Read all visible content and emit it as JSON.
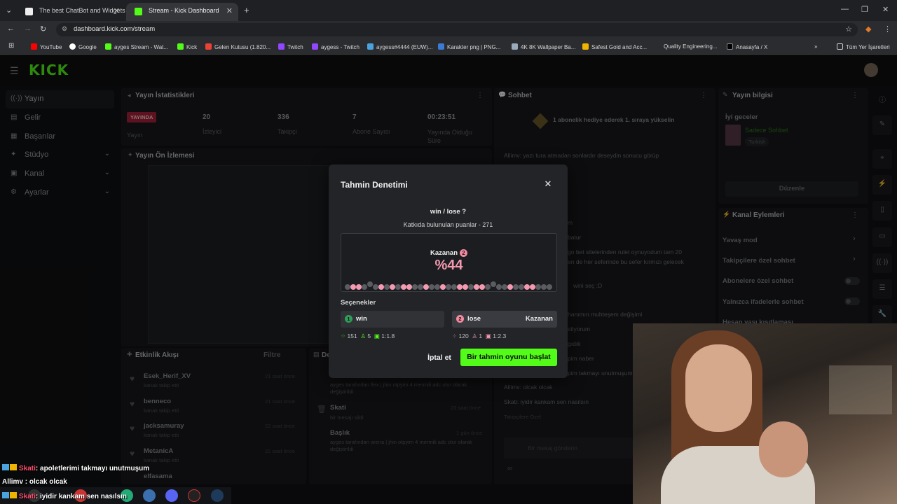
{
  "browser": {
    "tabs": [
      {
        "title": "The best ChatBot and Widgets",
        "active": false
      },
      {
        "title": "Stream - Kick Dashboard",
        "active": true
      }
    ],
    "url": "dashboard.kick.com/stream",
    "bookmarks": [
      "YouTube",
      "Google",
      "ayges Stream - Wat...",
      "Kick",
      "Gelen Kutusu (1.820...",
      "Twitch",
      "aygess - Twitch",
      "aygess#4444 (EUW)...",
      "Karakter png | PNG...",
      "4K 8K Wallpaper Ba...",
      "Safest Gold and Acc...",
      "Quality Engineering...",
      "Anasayfa / X"
    ],
    "all_bookmarks": "Tüm Yer İşaretleri"
  },
  "app": {
    "logo": "KICK",
    "sidebar": {
      "items": [
        {
          "label": "Yayın"
        },
        {
          "label": "Gelir"
        },
        {
          "label": "Başarılar"
        },
        {
          "label": "Stüdyo"
        },
        {
          "label": "Kanal"
        },
        {
          "label": "Ayarlar"
        }
      ]
    },
    "stats_panel": {
      "title": "Yayın İstatistikleri",
      "live_badge": "YAYINDA",
      "live_label": "Yayın",
      "stats": [
        {
          "value": "20",
          "label": "İzleyici"
        },
        {
          "value": "336",
          "label": "Takipçi"
        },
        {
          "value": "7",
          "label": "Abone Sayısı"
        },
        {
          "value": "00:23:51",
          "label": "Yayında Olduğu Süre"
        }
      ]
    },
    "preview_panel": {
      "title": "Yayın Ön İzlemesi"
    },
    "activity_panel": {
      "title": "Etkinlik Akışı",
      "filter": "Filtre",
      "items": [
        {
          "name": "Esek_Herif_XV",
          "sub": "kanalı takip etti",
          "time": "21 saat önce"
        },
        {
          "name": "benneco",
          "sub": "kanalı takip etti",
          "time": "21 saat önce"
        },
        {
          "name": "jacksamuray",
          "sub": "kanalı takip etti",
          "time": "22 saat önce"
        },
        {
          "name": "MetanicA",
          "sub": "kanalı takip etti",
          "time": "22 saat önce"
        },
        {
          "name": "elfasama",
          "sub": "",
          "time": ""
        }
      ]
    },
    "mod_panel": {
      "title": "De",
      "items": [
        {
          "name": "",
          "sub": "ayges tarafından flex | jhin otpyim 4 mermili adc olur olarak değiştirildi",
          "time": ""
        },
        {
          "name": "Skati",
          "sub": "bir mesajı sildi",
          "time": "23 saat önce"
        },
        {
          "name": "Başlık",
          "sub": "ayges tarafından arena | jhin otpyim 4 mermili adc olur olarak değiştirildi",
          "time": "1 gün önce"
        }
      ]
    },
    "chat_panel": {
      "title": "Sohbet",
      "pinned": "1 abonelik hediye ederek 1. sıraya yükselin",
      "lines": [
        "Allimv: yazı tura atmadan sonlardır deseydin sonucu görüp",
        "m",
        "batur",
        "go bet sitelerinden rulet oynuyodum tam 20",
        "en de her seferinde bu sefer kırmızı gelecek",
        "wini seç :D",
        "hanımın muhteşem değişimi",
        "stiyorum",
        "gıdık",
        "pim naber",
        "pim takmayı unutmuşum",
        "Allimv: olcak olcak",
        "Skati: iyidir kankam sen nasılsın"
      ],
      "follower_only": "Takipçilere Özel",
      "input_placeholder": "Bir mesaj gönderin",
      "footer": "∞"
    },
    "info_panel": {
      "title": "Yayın bilgisi",
      "stream_title": "İyi geceler",
      "category": "Sadece Sohbet",
      "language": "Turkish",
      "edit_button": "Düzenle"
    },
    "channel_actions": {
      "title": "Kanal Eylemleri",
      "rows": [
        {
          "label": "Yavaş mod",
          "kind": "chevron"
        },
        {
          "label": "Takipçilere özel sohbet",
          "kind": "chevron"
        },
        {
          "label": "Abonelere özel sohbet",
          "kind": "toggle"
        },
        {
          "label": "Yalnızca ifadelerle sohbet",
          "kind": "toggle"
        },
        {
          "label": "Hesap yaşı kısıtlaması",
          "kind": "chevron"
        }
      ]
    }
  },
  "modal": {
    "title": "Tahmin Denetimi",
    "question": "win / lose ?",
    "points_label": "Katkıda bulunulan puanlar - 271",
    "winner_label": "Kazanan",
    "winner_badge": "2",
    "winner_percent": "%44",
    "options_label": "Seçenekler",
    "options": [
      {
        "num": "1",
        "label": "win",
        "tag": "",
        "points": "151",
        "users": "5",
        "ratio": "1:1.8",
        "color": "#2e9e5a"
      },
      {
        "num": "2",
        "label": "lose",
        "tag": "Kazanan",
        "points": "120",
        "users": "1",
        "ratio": "1:2.3",
        "color": "#f38ba0"
      }
    ],
    "cancel_label": "İptal et",
    "start_label": "Bir tahmin oyunu başlat",
    "colors": {
      "accent": "#53fc18",
      "winner": "#f49ab0"
    }
  },
  "stream_overlay": {
    "chat": [
      {
        "user": "Skati",
        "text": ": apoletlerimi takmayı unutmuşum",
        "color": "#ff4d6d"
      },
      {
        "user": "Allimv",
        "text": " : olcak olcak",
        "color": "#ffffff"
      },
      {
        "user": "Skati",
        "text": ": iyidir kankam sen nasılsın",
        "color": "#ff4d6d"
      }
    ]
  }
}
